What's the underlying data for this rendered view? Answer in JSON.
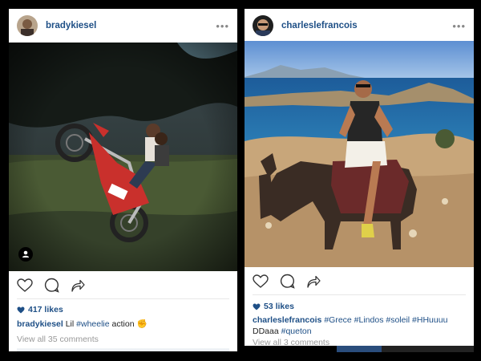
{
  "posts": [
    {
      "username": "bradykiesel",
      "likes": "417 likes",
      "caption_user": "bradykiesel",
      "caption_text_1": "Lil ",
      "caption_tag_1": "#wheelie",
      "caption_text_2": " action ✊",
      "view_all": "View all 35 comments"
    },
    {
      "username": "charleslefrancois",
      "likes": "53 likes",
      "caption_user": "charleslefrancois",
      "caption_tags": "#Grece #Lindos #soleil #HHuuuu",
      "caption_line2": "DDaaa ",
      "caption_tag_last": "#queton",
      "view_all": "View all 3 comments"
    }
  ],
  "colors": {
    "accent": "#1e4f86",
    "muted": "#999999",
    "background": "#000000"
  },
  "icons": [
    "heart-icon",
    "comment-icon",
    "share-icon",
    "more-icon",
    "user-tag-icon"
  ]
}
